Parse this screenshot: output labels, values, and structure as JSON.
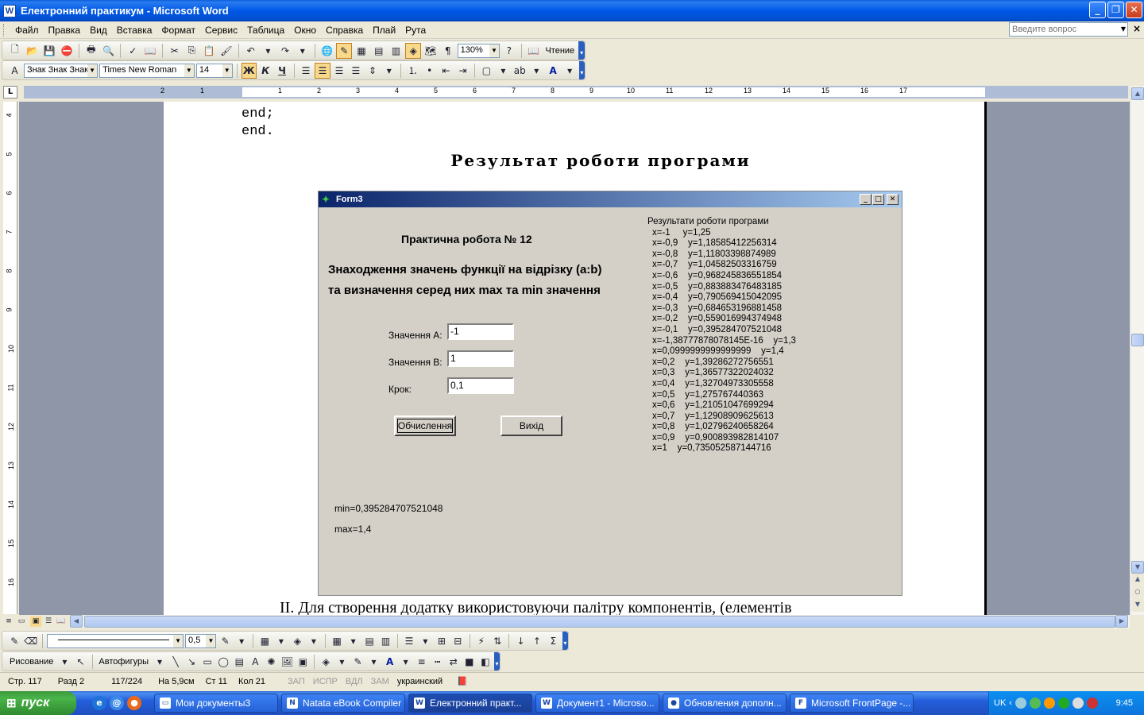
{
  "window": {
    "title": "Електронний практикум - Microsoft Word"
  },
  "menu": {
    "items": [
      "Файл",
      "Правка",
      "Вид",
      "Вставка",
      "Формат",
      "Сервис",
      "Таблица",
      "Окно",
      "Справка",
      "Плай",
      "Рута"
    ],
    "ask_placeholder": "Введите вопрос"
  },
  "toolbar_standard": {
    "zoom": "130%",
    "reading_label": "Чтение"
  },
  "toolbar_format": {
    "style": "Знак Знак Знак",
    "font": "Times New Roman",
    "size": "14",
    "bold": "Ж",
    "italic": "К",
    "underline": "Ч"
  },
  "ruler": {
    "h_numbers": [
      "2",
      "1",
      "1",
      "2",
      "3",
      "4",
      "5",
      "6",
      "7",
      "8",
      "9",
      "10",
      "11",
      "12",
      "13",
      "14",
      "15",
      "16",
      "17"
    ],
    "v_numbers": [
      "4",
      "5",
      "6",
      "7",
      "8",
      "9",
      "10",
      "11",
      "12",
      "13",
      "14",
      "15",
      "16"
    ]
  },
  "document": {
    "code_lines": [
      "end;",
      "end."
    ],
    "heading": "Результат роботи програми",
    "paragraph": "ІІ. Для створення додатку використовуючи палітру компонентів, (елементів"
  },
  "form": {
    "title": "Form3",
    "subtitle": "Практична робота № 12",
    "task_line1": "Знаходження значень функції на відрізку (a:b)",
    "task_line2": "та визначення серед них max та min значення",
    "label_a": "Значення A:",
    "label_b": "Значення B:",
    "label_step": "Крок:",
    "value_a": "-1",
    "value_b": "1",
    "value_step": "0,1",
    "btn_compute": "Обчислення",
    "btn_exit": "Вихід",
    "min_text": "min=0,395284707521048",
    "max_text": "max=1,4",
    "results_head": "Результати роботи програми",
    "results": [
      "x=-1     y=1,25",
      "x=-0,9    y=1,18585412256314",
      "x=-0,8    y=1,11803398874989",
      "x=-0,7    y=1,04582503316759",
      "x=-0,6    y=0,968245836551854",
      "x=-0,5    y=0,883883476483185",
      "x=-0,4    y=0,790569415042095",
      "x=-0,3    y=0,684653196881458",
      "x=-0,2    y=0,559016994374948",
      "x=-0,1    y=0,395284707521048",
      "x=-1,38777878078145E-16    y=1,3",
      "x=0,0999999999999999    y=1,4",
      "x=0,2    y=1,39286272756551",
      "x=0,3    y=1,36577322024032",
      "x=0,4    y=1,32704973305558",
      "x=0,5    y=1,275767440363",
      "x=0,6    y=1,21051047699294",
      "x=0,7    y=1,12908909625613",
      "x=0,8    y=1,02796240658264",
      "x=0,9    y=0,900893982814107",
      "x=1    y=0,735052587144716"
    ]
  },
  "toolbar_drawing": {
    "line_width": "0,5",
    "draw_label": "Рисование",
    "autoshapes_label": "Автофигуры"
  },
  "status": {
    "page": "Стр. 117",
    "section": "Разд 2",
    "pages": "117/224",
    "at": "На 5,9см",
    "line": "Ст 11",
    "col": "Кол 21",
    "rec": "ЗАП",
    "trk": "ИСПР",
    "ext": "ВДЛ",
    "ovr": "ЗАМ",
    "lang": "украинский"
  },
  "taskbar": {
    "start": "пуск",
    "tasks": [
      "Мои документы3",
      "Natata eBook Compiler",
      "Електронний практ...",
      "Документ1 - Microso...",
      "Обновления дополн...",
      "Microsoft FrontPage -..."
    ],
    "lang": "UK",
    "clock": "9:45"
  }
}
